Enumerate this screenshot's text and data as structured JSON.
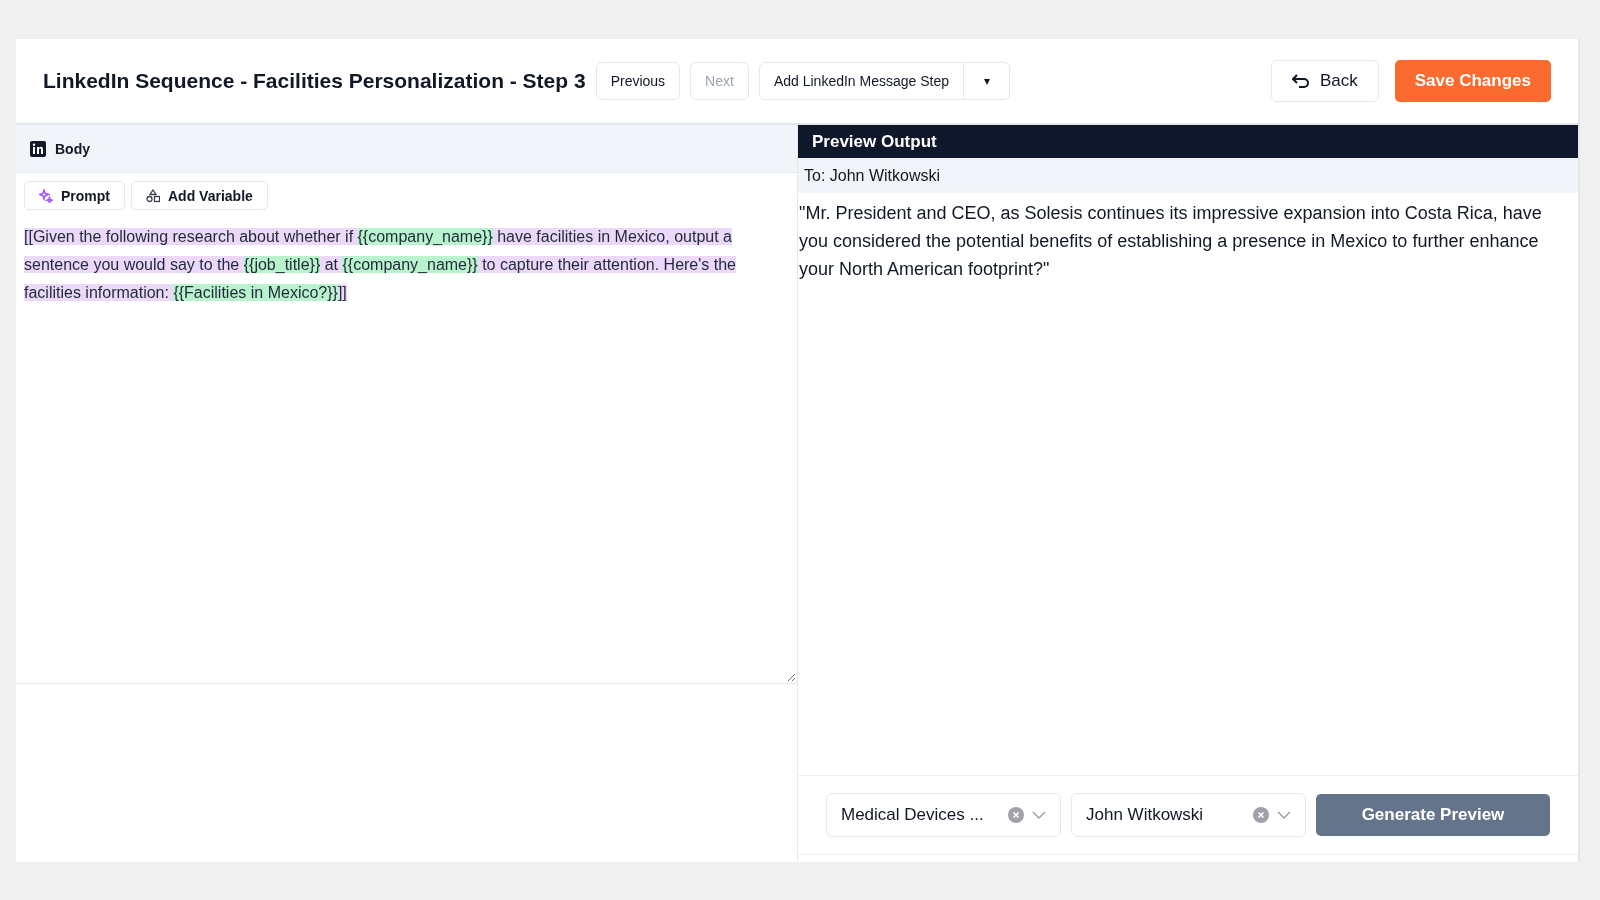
{
  "header": {
    "title": "LinkedIn Sequence - Facilities Personalization - Step 3",
    "buttons": [
      {
        "label": "Previous",
        "disabled": false
      },
      {
        "label": "Next",
        "disabled": true
      }
    ],
    "split_button": {
      "label": "Add LinkedIn Message Step",
      "caret": "▾"
    },
    "back": "Back",
    "save": "Save Changes"
  },
  "editor": {
    "tab": "Body",
    "tools": [
      {
        "kind": "prompt",
        "label": "Prompt"
      },
      {
        "kind": "variable",
        "label": "Add Variable"
      }
    ],
    "segments": [
      {
        "kind": "text",
        "text": "[[Given the following research about whether if "
      },
      {
        "kind": "variable",
        "text": "{{company_name}}"
      },
      {
        "kind": "text",
        "text": " have facilities in Mexico, output a sentence you would say to the "
      },
      {
        "kind": "variable",
        "text": "{{job_title}}"
      },
      {
        "kind": "text",
        "text": " at "
      },
      {
        "kind": "variable",
        "text": "{{company_name}}"
      },
      {
        "kind": "text",
        "text": " to capture their attention. Here's the facilities information: "
      },
      {
        "kind": "variable",
        "text": "{{Facilities in Mexico?}}"
      },
      {
        "kind": "text",
        "text": "]]"
      }
    ]
  },
  "preview": {
    "title": "Preview Output",
    "to": "To: John Witkowski",
    "output": "\"Mr. President and CEO, as Solesis continues its impressive expansion into Costa Rica, have you considered the potential benefits of establishing a presence in Mexico to further enhance your North American footprint?\"",
    "selects": [
      {
        "value": "Medical Devices ..."
      },
      {
        "value": "John Witkowski"
      }
    ],
    "generate": "Generate Preview"
  }
}
